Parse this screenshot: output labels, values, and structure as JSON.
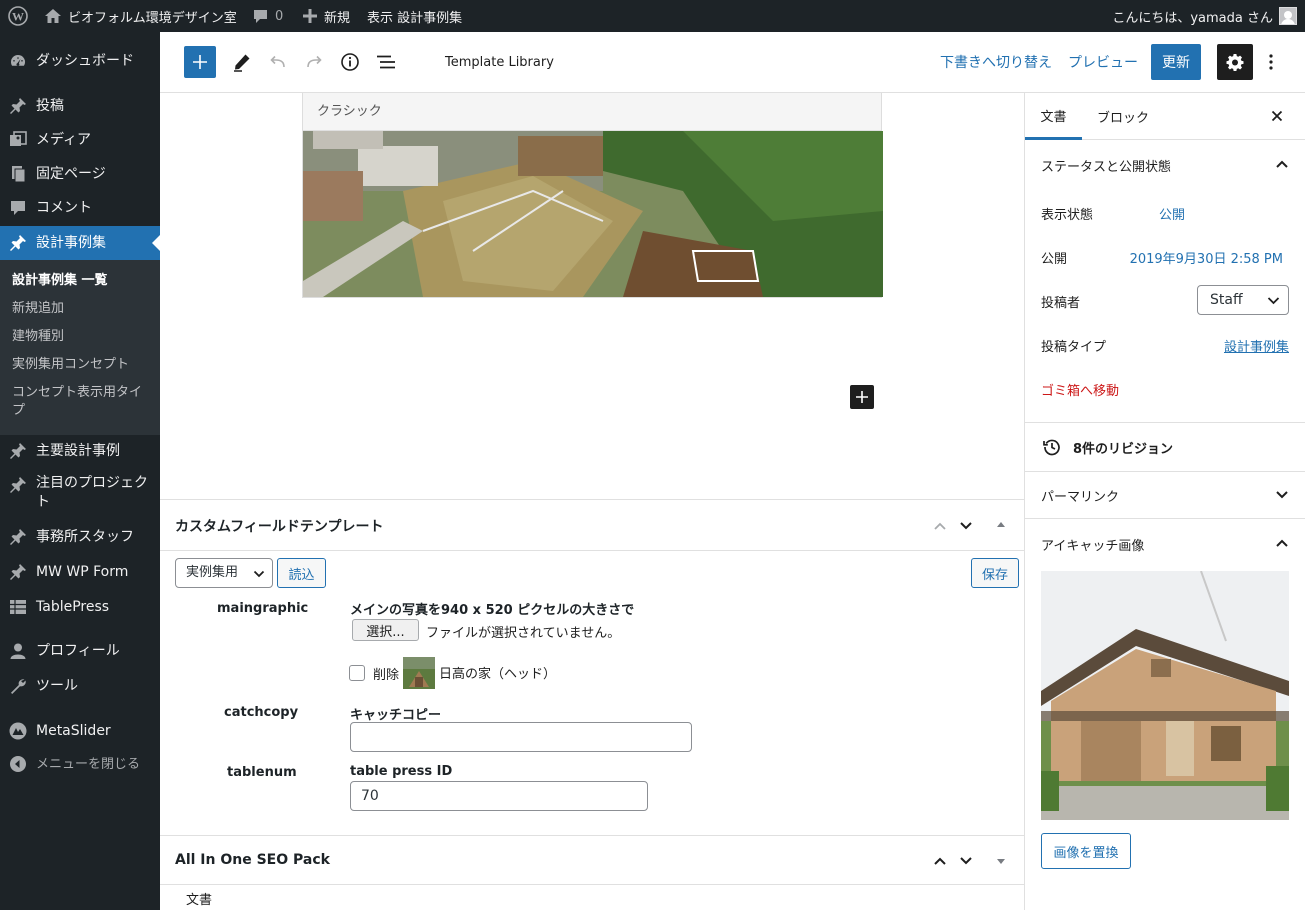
{
  "admin_bar": {
    "site_name": "ビオフォルム環境デザイン室",
    "comments_count": "0",
    "new_label": "新規",
    "view_label": "表示 設計事例集",
    "greeting": "こんにちは、yamada さん"
  },
  "sidebar": {
    "items": [
      {
        "label": "ダッシュボード",
        "icon": "dashboard-icon"
      },
      {
        "label": "投稿",
        "icon": "pin-icon"
      },
      {
        "label": "メディア",
        "icon": "media-icon"
      },
      {
        "label": "固定ページ",
        "icon": "page-icon"
      },
      {
        "label": "コメント",
        "icon": "comment-icon"
      },
      {
        "label": "設計事例集",
        "icon": "pin-icon"
      },
      {
        "label": "主要設計事例",
        "icon": "pin-icon"
      },
      {
        "label": "注目のプロジェクト",
        "icon": "pin-icon"
      },
      {
        "label": "事務所スタッフ",
        "icon": "pin-icon"
      },
      {
        "label": "MW WP Form",
        "icon": "pin-icon"
      },
      {
        "label": "TablePress",
        "icon": "table-icon"
      },
      {
        "label": "プロフィール",
        "icon": "user-icon"
      },
      {
        "label": "ツール",
        "icon": "wrench-icon"
      },
      {
        "label": "MetaSlider",
        "icon": "metaslider-icon"
      },
      {
        "label": "メニューを閉じる",
        "icon": "collapse-icon"
      }
    ],
    "submenu": [
      "設計事例集 一覧",
      "新規追加",
      "建物種別",
      "実例集用コンセプト",
      "コンセプト表示用タイプ"
    ]
  },
  "toolbar": {
    "title": "Template Library",
    "switch_draft": "下書きへ切り替え",
    "preview": "プレビュー",
    "update": "更新"
  },
  "editor": {
    "classic_label": "クラシック"
  },
  "custom_field": {
    "title": "カスタムフィールドテンプレート",
    "template_select": "実例集用",
    "load_button": "読込",
    "save_button": "保存",
    "fields": {
      "maingraphic_label": "maingraphic",
      "maingraphic_desc": "メインの写真を940 x 520 ピクセルの大きさで",
      "file_button": "選択...",
      "file_status": "ファイルが選択されていません。",
      "delete_label": "削除",
      "image_name": "日高の家（ヘッド）",
      "catchcopy_label": "catchcopy",
      "catchcopy_desc": "キャッチコピー",
      "catchcopy_value": "",
      "tablenum_label": "tablenum",
      "tablenum_desc": "table press ID",
      "tablenum_value": "70"
    }
  },
  "seo_box": {
    "title": "All In One SEO Pack"
  },
  "footer": {
    "breadcrumb": "文書"
  },
  "inspector": {
    "tab_document": "文書",
    "tab_block": "ブロック",
    "status_title": "ステータスと公開状態",
    "visibility_label": "表示状態",
    "visibility_value": "公開",
    "publish_label": "公開",
    "publish_value": "2019年9月30日 2:58 PM",
    "author_label": "投稿者",
    "author_value": "Staff",
    "post_type_label": "投稿タイプ",
    "post_type_value": "設計事例集",
    "trash_label": "ゴミ箱へ移動",
    "revisions": "8件のリビジョン",
    "permalink": "パーマリンク",
    "featured_image": "アイキャッチ画像",
    "replace_image": "画像を置換"
  },
  "colors": {
    "admin_dark": "#1d2327",
    "accent_blue": "#2271b1",
    "trash_red": "#cc1818"
  }
}
